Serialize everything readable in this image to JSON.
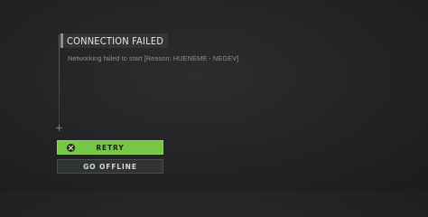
{
  "dialog": {
    "title": "CONNECTION FAILED",
    "message": "Networking failed to start [Reason: HUENEME - NEGEV]"
  },
  "buttons": {
    "retry_label": "RETRY",
    "retry_prompt_icon": "x-button-icon",
    "offline_label": "GO OFFLINE"
  },
  "colors": {
    "accent_green": "#78c648",
    "background": "#232526",
    "title_text": "#e6e6e6",
    "message_text": "#8d8f90"
  }
}
